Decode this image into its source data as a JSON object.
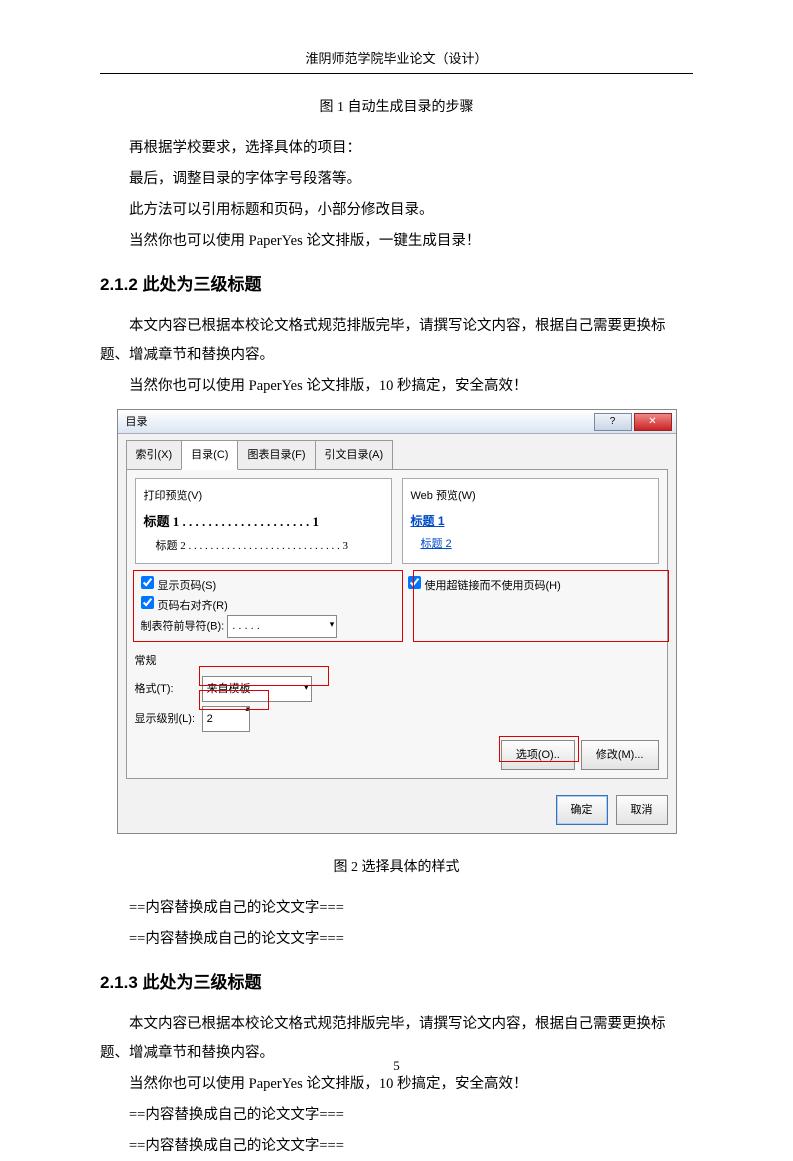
{
  "header": "淮阴师范学院毕业论文（设计）",
  "fig1_caption": "图 1  自动生成目录的步骤",
  "p1": "再根据学校要求，选择具体的项目：",
  "p2": "最后，调整目录的字体字号段落等。",
  "p3": "此方法可以引用标题和页码，小部分修改目录。",
  "p4": "当然你也可以使用 PaperYes 论文排版，一键生成目录！",
  "h212": "2.1.2  此处为三级标题",
  "p5": "本文内容已根据本校论文格式规范排版完毕，请撰写论文内容，根据自己需要更换标题、增减章节和替换内容。",
  "p6": "当然你也可以使用 PaperYes 论文排版，10 秒搞定，安全高效！",
  "dialog": {
    "title": "目录",
    "tabs": [
      "索引(X)",
      "目录(C)",
      "图表目录(F)",
      "引文目录(A)"
    ],
    "active_tab": 1,
    "left_label": "打印预览(V)",
    "toc_bold": "标题 1 . . . . . . . . . . . . . . . . . . . . 1",
    "toc_sub": "标题 2 . . . . . . . . . . . . . . . . . . . . . . . . . . . . 3",
    "right_label": "Web 预览(W)",
    "link1": "标题 1",
    "link2": "标题 2",
    "chk1": "显示页码(S)",
    "chk2": "页码右对齐(R)",
    "chk3": "使用超链接而不使用页码(H)",
    "leader_label": "制表符前导符(B):",
    "leader_value": ". . . . .",
    "general_label": "常规",
    "format_label": "格式(T):",
    "format_value": "来自模板",
    "level_label": "显示级别(L):",
    "level_value": "2",
    "btn_options": "选项(O)..",
    "btn_modify": "修改(M)...",
    "btn_ok": "确定",
    "btn_cancel": "取消"
  },
  "fig2_caption": "图 2  选择具体的样式",
  "p7": "==内容替换成自己的论文文字===",
  "p8": "==内容替换成自己的论文文字===",
  "h213": "2.1.3  此处为三级标题",
  "p9": "本文内容已根据本校论文格式规范排版完毕，请撰写论文内容，根据自己需要更换标题、增减章节和替换内容。",
  "p10": "当然你也可以使用 PaperYes 论文排版，10 秒搞定，安全高效！",
  "p11": "==内容替换成自己的论文文字===",
  "p12": "==内容替换成自己的论文文字===",
  "page_number": "5"
}
